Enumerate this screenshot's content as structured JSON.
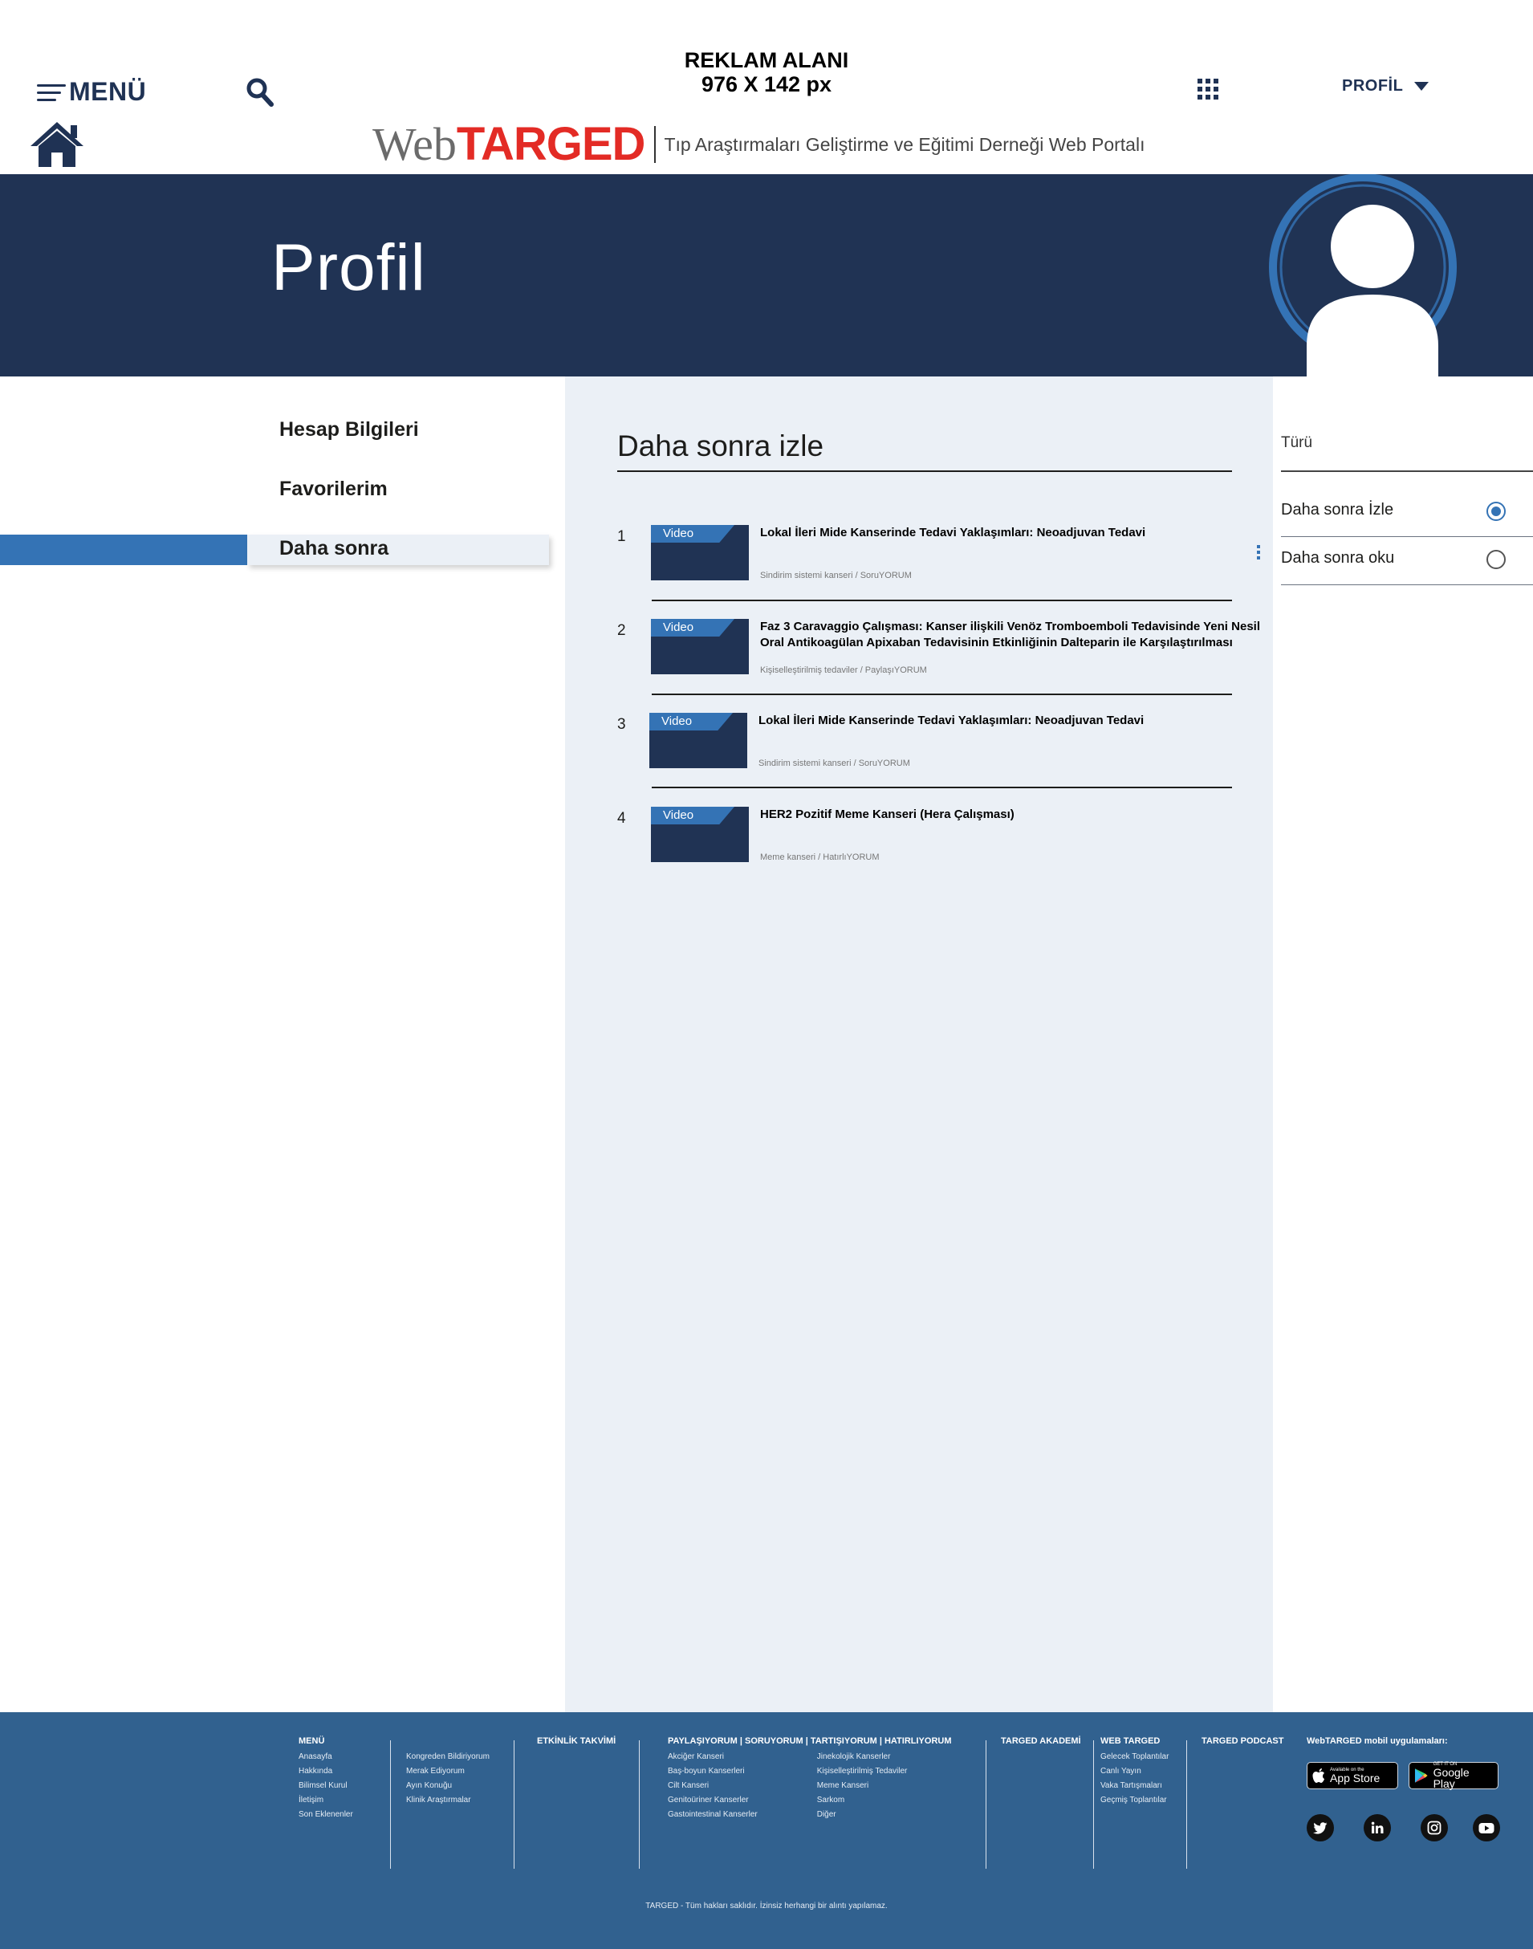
{
  "header": {
    "menu_label": "MENÜ",
    "ad_line1": "REKLAM ALANI",
    "ad_line2": "976 X 142 px",
    "profile_label": "PROFİL",
    "brand_web": "Web",
    "brand_targed": "TARGED",
    "tagline": "Tıp Araştırmaları Geliştirme ve Eğitimi Derneği Web Portalı",
    "icons": [
      "menu-icon",
      "search-icon",
      "apps-grid-icon",
      "caret-down-icon",
      "home-icon"
    ]
  },
  "banner": {
    "title": "Profil",
    "colors": {
      "background": "#203354",
      "ring": "#3473b5"
    }
  },
  "sidebar": {
    "items": [
      "Hesap Bilgileri",
      "Favorilerim",
      "Daha sonra"
    ],
    "active_index": 2,
    "colors": {
      "active_bar": "#3473b5",
      "active_bg": "#ebf0f6"
    }
  },
  "main": {
    "heading": "Daha sonra izle",
    "items": [
      {
        "num": "1",
        "tag": "Video",
        "title": "Lokal İleri Mide Kanserinde Tedavi Yaklaşımları: Neoadjuvan Tedavi",
        "meta": "Sindirim sistemi kanseri / SoruYORUM"
      },
      {
        "num": "2",
        "tag": "Video",
        "title": "Faz 3 Caravaggio Çalışması: Kanser ilişkili Venöz Tromboemboli Tedavisinde Yeni Nesil Oral Antikoagülan Apixaban Tedavisinin Etkinliğinin Dalteparin ile Karşılaştırılması",
        "meta": "Kişiselleştirilmiş tedaviler / PaylaşıYORUM"
      },
      {
        "num": "3",
        "tag": "Video",
        "title": "Lokal İleri Mide Kanserinde Tedavi Yaklaşımları: Neoadjuvan Tedavi",
        "meta": "Sindirim sistemi kanseri / SoruYORUM"
      },
      {
        "num": "4",
        "tag": "Video",
        "title": "HER2 Pozitif Meme Kanseri (Hera Çalışması)",
        "meta": "Meme kanseri / HatırlıYORUM"
      }
    ]
  },
  "filter": {
    "title": "Türü",
    "options": [
      {
        "label": "Daha sonra İzle",
        "checked": true
      },
      {
        "label": "Daha sonra oku",
        "checked": false
      }
    ]
  },
  "footer": {
    "menu": {
      "heading": "MENÜ",
      "links": [
        "Anasayfa",
        "Hakkında",
        "Bilimsel Kurul",
        "İletişim",
        "Son Eklenenler"
      ]
    },
    "menu2": {
      "links": [
        "Kongreden Bildiriyorum",
        "Merak Ediyorum",
        "Ayın Konuğu",
        "Klinik Araştırmalar"
      ]
    },
    "events": {
      "heading": "ETKİNLİK TAKVİMİ"
    },
    "forums": {
      "heading": "PAYLAŞIYORUM   |   SORUYORUM   |   TARTIŞIYORUM   |   HATIRLIYORUM",
      "links_left": [
        "Akciğer Kanseri",
        "Baş-boyun Kanserleri",
        "Cilt Kanseri",
        "Genitoüriner Kanserler",
        "Gastointestinal Kanserler"
      ],
      "links_right": [
        "Jinekolojik Kanserler",
        "Kişiselleştirilmiş Tedaviler",
        "Meme Kanseri",
        "Sarkom",
        "Diğer"
      ]
    },
    "academy": {
      "heading": "TARGED AKADEMİ"
    },
    "webtarged": {
      "heading": "WEB TARGED",
      "links": [
        "Gelecek Toplantılar",
        "Canlı Yayın",
        "Vaka Tartışmaları",
        "Geçmiş Toplantılar"
      ]
    },
    "podcast": {
      "heading": "TARGED PODCAST"
    },
    "apps": {
      "heading": "WebTARGED mobil uygulamaları:",
      "appstore_small": "Available on the",
      "appstore_big": "App Store",
      "googleplay_small": "GET IT ON",
      "googleplay_big": "Google Play"
    },
    "social_icons": [
      "twitter-icon",
      "linkedin-icon",
      "instagram-icon",
      "youtube-icon"
    ],
    "copyright": "TARGED - Tüm hakları saklıdır. İzinsiz herhangi bir alıntı yapılamaz.",
    "colors": {
      "background": "#31618f"
    }
  }
}
